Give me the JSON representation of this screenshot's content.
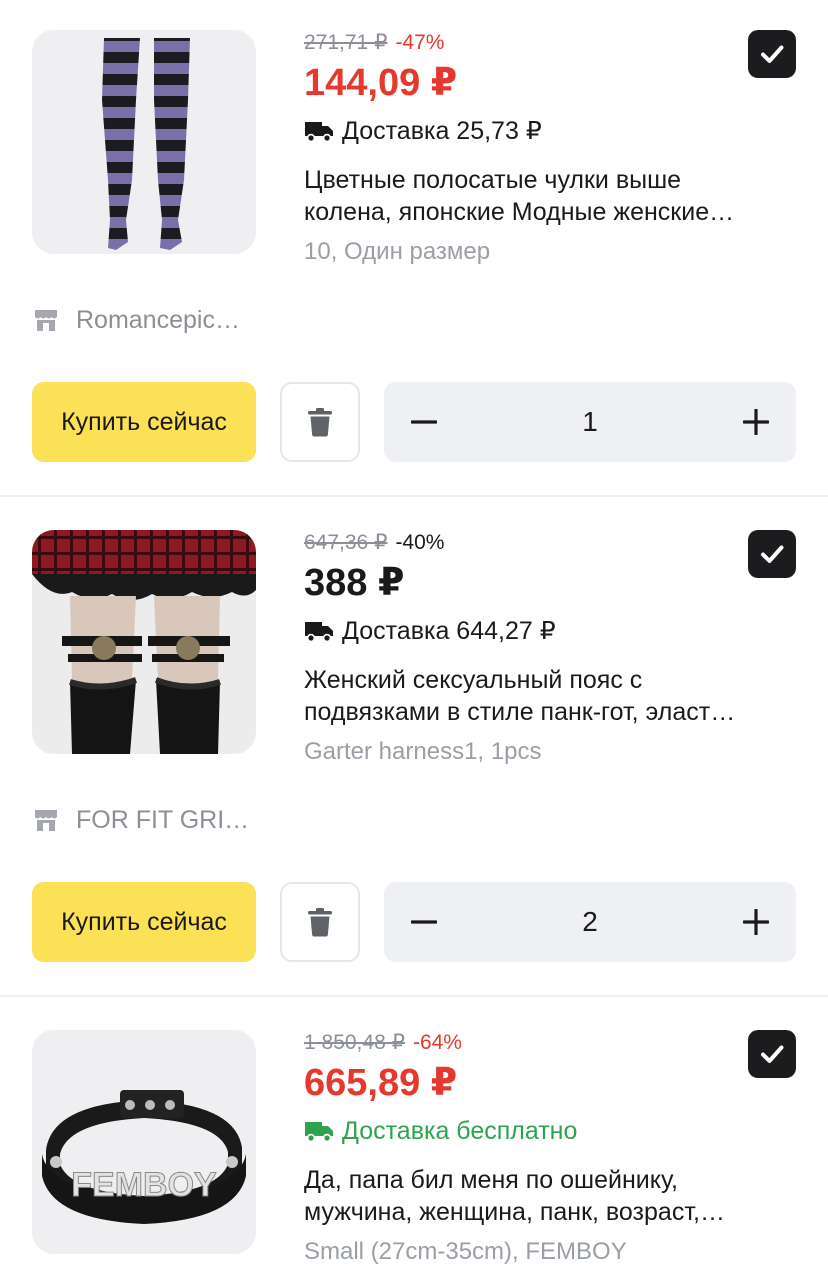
{
  "colors": {
    "accent_red": "#e5382f",
    "delivery_green": "#2ea34d",
    "buy_yellow": "#fbe156",
    "checkbox_dark": "#1c1c1e"
  },
  "items": [
    {
      "old_price": "271,71 ₽",
      "discount": "-47%",
      "price": "144,09 ₽",
      "delivery": "Доставка 25,73 ₽",
      "title_line1": "Цветные полосатые чулки выше",
      "title_line2": "колена, японские Модные женские…",
      "variant": "10, Один размер",
      "store": "Romancepic…",
      "buy_label": "Купить сейчас",
      "quantity": "1",
      "checked": true,
      "image_icon": "striped-stockings-image"
    },
    {
      "old_price": "647,36 ₽",
      "discount": "-40%",
      "price": "388 ₽",
      "delivery": "Доставка 644,27 ₽",
      "title_line1": "Женский сексуальный пояс с",
      "title_line2": "подвязками в стиле панк-гот, эласт…",
      "variant": "Garter harness1, 1pcs",
      "store": "FOR FIT GRI…",
      "buy_label": "Купить сейчас",
      "quantity": "2",
      "checked": true,
      "image_icon": "garter-harness-image"
    },
    {
      "old_price": "1 850,48 ₽",
      "discount": "-64%",
      "price": "665,89 ₽",
      "delivery": "Доставка бесплатно",
      "title_line1": "Да, папа бил меня по ошейнику,",
      "title_line2": "мужчина, женщина, панк, возраст,…",
      "variant": "Small (27cm-35cm), FEMBOY",
      "collar_text": "FEMBOY",
      "checked": true,
      "image_icon": "femboy-collar-image"
    }
  ]
}
